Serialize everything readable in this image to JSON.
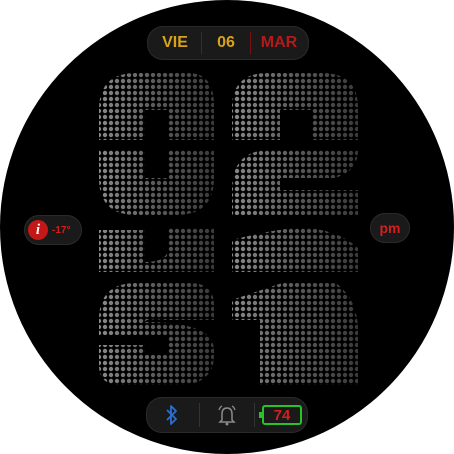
{
  "date": {
    "day": "VIE",
    "num": "06",
    "month": "MAR"
  },
  "weather": {
    "temp": "-17°",
    "icon": "info-icon"
  },
  "ampm": "pm",
  "time": {
    "hours": "02",
    "minutes": "31"
  },
  "status": {
    "bluetooth_icon": "bluetooth-icon",
    "alarm_icon": "alarm-icon",
    "battery": "74"
  },
  "colors": {
    "gold": "#d8a21c",
    "red": "#b31a1a",
    "green": "#29c229",
    "blue": "#2a6fd8"
  }
}
